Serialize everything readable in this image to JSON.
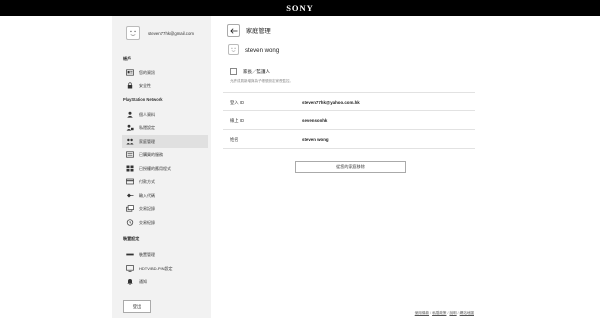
{
  "header": {
    "logo": "SONY"
  },
  "user": {
    "email": "steven77hk@gmail.com"
  },
  "sidebar": {
    "sections": [
      {
        "title": "帳戶"
      },
      {
        "title": "PlayStation Network"
      },
      {
        "title": "裝置設定"
      }
    ],
    "items": [
      {
        "label": "您的資訊",
        "icon": "id-card-icon"
      },
      {
        "label": "安全性",
        "icon": "lock-icon"
      },
      {
        "label": "個人資料",
        "icon": "profile-icon"
      },
      {
        "label": "私隱設定",
        "icon": "privacy-lock-icon"
      },
      {
        "label": "家庭管理",
        "icon": "family-icon"
      },
      {
        "label": "已購買的服務",
        "icon": "services-icon"
      },
      {
        "label": "已授權的應用程式",
        "icon": "apps-icon"
      },
      {
        "label": "付款方式",
        "icon": "credit-card-icon"
      },
      {
        "label": "輸入代碼",
        "icon": "code-icon"
      },
      {
        "label": "交易記錄",
        "icon": "transaction-icon"
      },
      {
        "label": "交易紀錄",
        "icon": "history-icon"
      },
      {
        "label": "裝置管理",
        "icon": "device-icon"
      },
      {
        "label": "HDTV/BD-PIN設定",
        "icon": "tv-icon"
      },
      {
        "label": "通知",
        "icon": "bell-icon"
      }
    ],
    "active_index": 4,
    "logout_label": "登出"
  },
  "main": {
    "title": "家庭管理",
    "member_name": "steven wong",
    "guardian_label": "家長／監護人",
    "guardian_hint": "允許成員新增與為子帳號設定家長監控。",
    "rows": [
      {
        "label": "登入 ID",
        "value": "steven77hk@yahoo.com.hk"
      },
      {
        "label": "線上 ID",
        "value": "sevensonhk"
      },
      {
        "label": "姓名",
        "value": "steven wong"
      }
    ],
    "remove_label": "從您的家庭移除"
  },
  "footer": {
    "links": [
      "使用條款",
      "私隱政策",
      "說明",
      "網站地圖"
    ]
  }
}
